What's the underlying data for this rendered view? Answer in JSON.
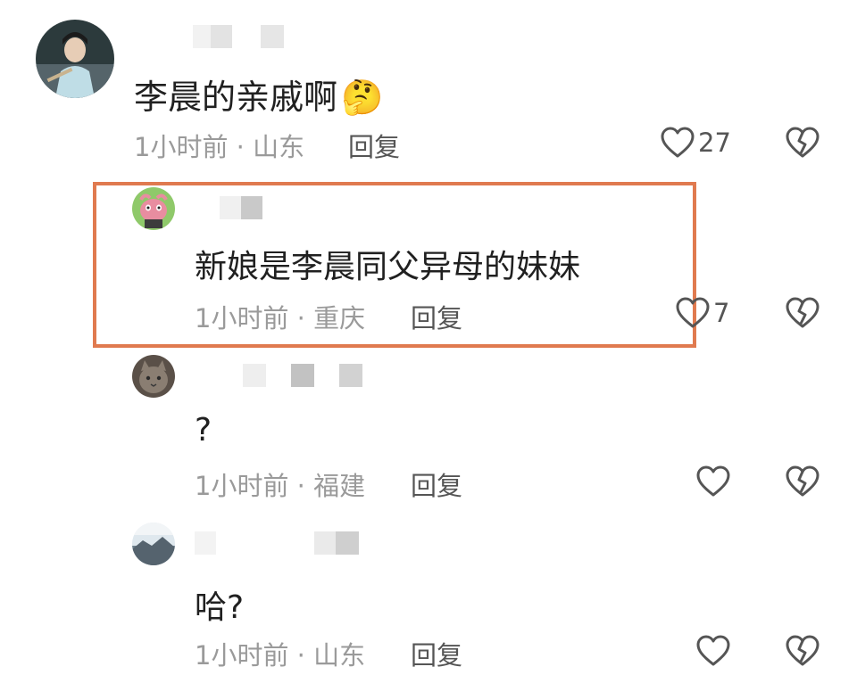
{
  "comments": [
    {
      "text": "李晨的亲戚啊",
      "emoji": "🤔",
      "time": "1小时前",
      "separator": "·",
      "location": "山东",
      "reply_label": "回复",
      "like_count": "27"
    },
    {
      "text": "新娘是李晨同父异母的妹妹",
      "time": "1小时前",
      "separator": "·",
      "location": "重庆",
      "reply_label": "回复",
      "like_count": "7"
    },
    {
      "text": "?",
      "time": "1小时前",
      "separator": "·",
      "location": "福建",
      "reply_label": "回复",
      "like_count": ""
    },
    {
      "text": "哈?",
      "time": "1小时前",
      "separator": "·",
      "location": "山东",
      "reply_label": "回复",
      "like_count": ""
    }
  ],
  "colors": {
    "highlight_border": "#e07a4f",
    "meta_text": "#9a9a9a",
    "content_text": "#202020"
  },
  "icons": {
    "like": "heart-outline-icon",
    "dislike": "broken-heart-icon"
  }
}
